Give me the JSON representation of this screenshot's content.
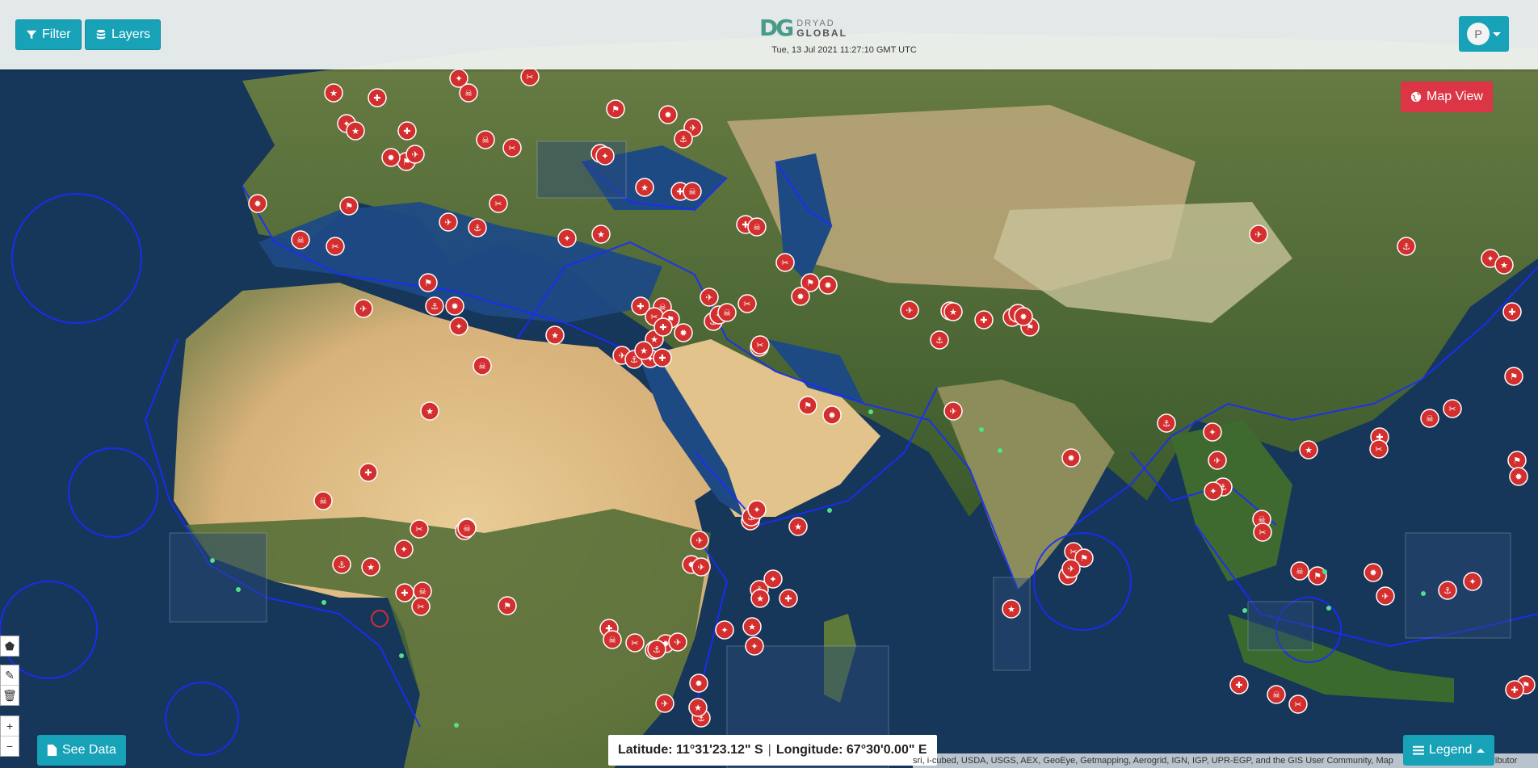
{
  "header": {
    "filter_label": "Filter",
    "layers_label": "Layers",
    "logo_mark": "DG",
    "logo_line1": "DRYAD",
    "logo_line2": "GLOBAL",
    "datetime": "Tue, 13 Jul 2021 11:27:10 GMT UTC",
    "user_initial": "P"
  },
  "map": {
    "view_button_label": "Map View",
    "basemap": "satellite imagery",
    "see_data_label": "See Data",
    "latitude_text": "Latitude: 11°31'23.12\" S",
    "separator": "|",
    "longitude_text": "Longitude: 67°30'0.00\" E",
    "attribution": "sri, i-cubed, USDA, USGS, AEX, GeoEye, Getmapping, Aerogrid, IGN, IGP, UPR-EGP, and the GIS User Community, Map",
    "attribution_tail": "ontributor",
    "legend_label": "Legend",
    "zoom_in": "+",
    "zoom_out": "−",
    "colors": {
      "marker": "#d32f2f",
      "boundary": "#1a2cff",
      "accent": "#17a2b8",
      "danger": "#dc3545"
    },
    "incident_types": [
      "protest-icon",
      "star-icon",
      "medical-cross-icon",
      "skull-icon",
      "weapon-icon",
      "crowd-icon",
      "explosion-icon",
      "plane-icon",
      "ship-icon"
    ]
  }
}
